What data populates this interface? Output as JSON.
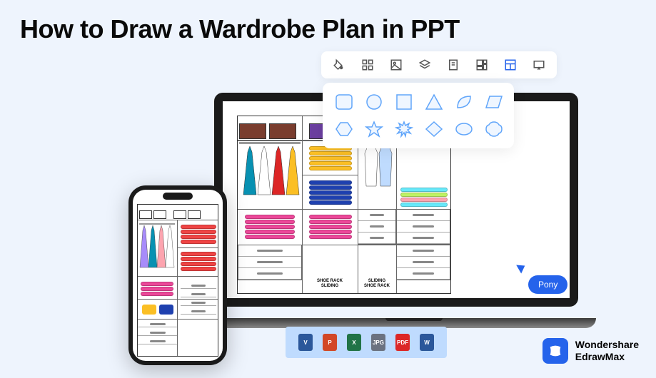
{
  "title": "How to Draw a Wardrobe Plan in PPT",
  "toolbar": {
    "icons": [
      "fill",
      "grid",
      "image",
      "layers",
      "page",
      "layout",
      "panel",
      "present"
    ],
    "active_index": 6
  },
  "shape_palette": {
    "row1": [
      "rounded-square",
      "circle",
      "square",
      "triangle",
      "leaf",
      "parallelogram"
    ],
    "row2": [
      "hexagon",
      "star",
      "burst",
      "diamond",
      "ellipse",
      "badge"
    ]
  },
  "cursor": {
    "label": "Pony"
  },
  "wardrobe": {
    "labels": {
      "left": "SHOE RACK\nSLIDING",
      "right": "SLIDING\nSHOE RACK"
    }
  },
  "export_formats": [
    {
      "name": "visio",
      "letter": "V",
      "class": "fmt-v"
    },
    {
      "name": "powerpoint",
      "letter": "P",
      "class": "fmt-p"
    },
    {
      "name": "excel",
      "letter": "X",
      "class": "fmt-x"
    },
    {
      "name": "jpg",
      "letter": "JPG",
      "class": "fmt-jpg"
    },
    {
      "name": "pdf",
      "letter": "PDF",
      "class": "fmt-pdf"
    },
    {
      "name": "word",
      "letter": "W",
      "class": "fmt-w"
    }
  ],
  "brand": {
    "line1": "Wondershare",
    "line2": "EdrawMax"
  }
}
